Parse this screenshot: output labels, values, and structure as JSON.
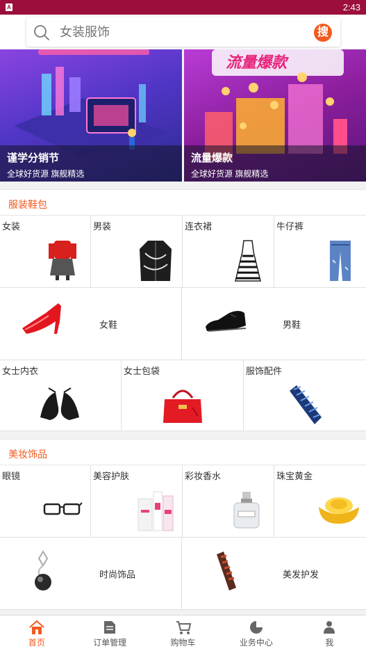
{
  "statusbar": {
    "time": "2:43",
    "app_icon": "A"
  },
  "search": {
    "placeholder": "女装服饰",
    "button_label": "搜"
  },
  "banners": [
    {
      "title": "谨学分销节",
      "subtitle": "全球好货源 旗舰精选"
    },
    {
      "title": "流量爆款",
      "subtitle": "全球好货源 旗舰精选"
    }
  ],
  "sections": [
    {
      "title": "服装鞋包",
      "rows": [
        [
          "女装",
          "男装",
          "连衣裙",
          "牛仔裤"
        ],
        [
          "女鞋",
          "男鞋"
        ],
        [
          "女士内衣",
          "女士包袋",
          "服饰配件"
        ]
      ]
    },
    {
      "title": "美妆饰品",
      "rows": [
        [
          "眼镜",
          "美容护肤",
          "彩妆香水",
          "珠宝黄金"
        ],
        [
          "时尚饰品",
          "美发护发"
        ]
      ]
    }
  ],
  "tabbar": {
    "items": [
      "首页",
      "订单管理",
      "购物车",
      "业务中心",
      "我"
    ],
    "active": "首页"
  },
  "colors": {
    "accent": "#f25a1f",
    "statusbar": "#9b0f3a"
  }
}
